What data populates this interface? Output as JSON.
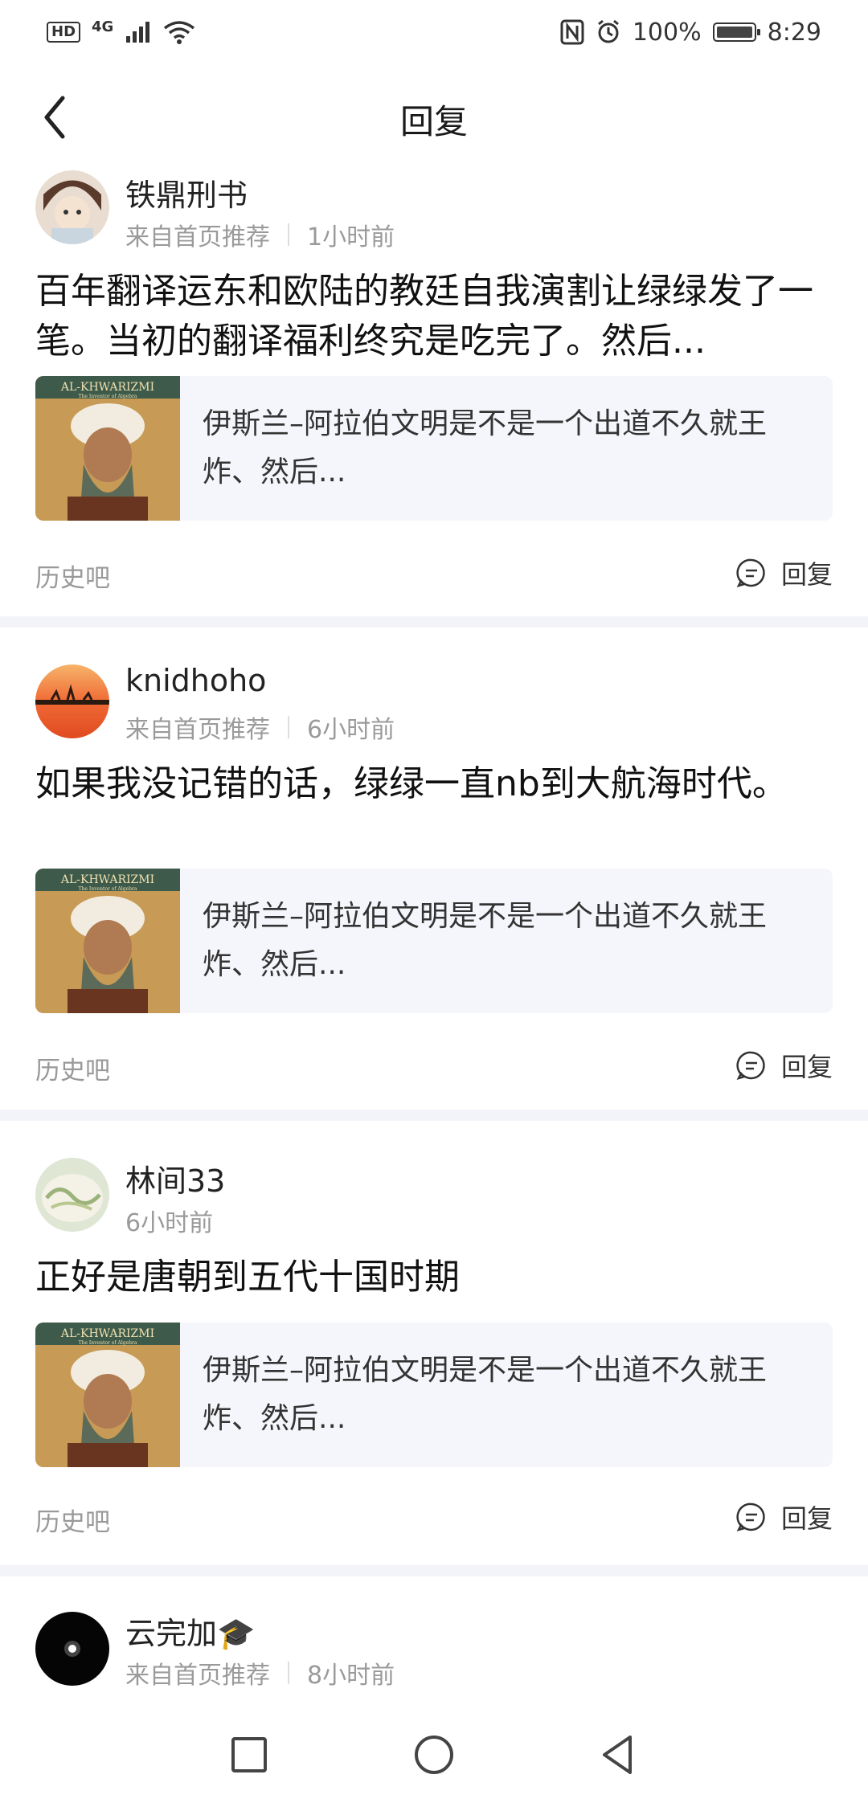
{
  "status_bar": {
    "hd": "HD",
    "network": "4G",
    "battery": "100%",
    "battery_level": 1.0,
    "time": "8:29"
  },
  "header": {
    "title": "回复"
  },
  "posts": [
    {
      "username": "铁鼎刑书",
      "source": "来自首页推荐",
      "time": "1小时前",
      "content": "百年翻译运东和欧陆的教廷自我演割让绿绿发了一笔。当初的翻译福利终究是吃完了。然后...",
      "quote_text": "伊斯兰–阿拉伯文明是不是一个出道不久就王炸、然后...",
      "forum": "历史吧",
      "reply_label": "回复"
    },
    {
      "username": "knidhoho",
      "source": "来自首页推荐",
      "time": "6小时前",
      "content": "如果我没记错的话，绿绿一直nb到大航海时代。",
      "quote_text": "伊斯兰–阿拉伯文明是不是一个出道不久就王炸、然后...",
      "forum": "历史吧",
      "reply_label": "回复"
    },
    {
      "username": "林间33",
      "source": "",
      "time": "6小时前",
      "content": "正好是唐朝到五代十国时期",
      "quote_text": "伊斯兰–阿拉伯文明是不是一个出道不久就王炸、然后...",
      "forum": "历史吧",
      "reply_label": "回复"
    },
    {
      "username": "云完加🎓",
      "source": "来自首页推荐",
      "time": "8小时前"
    }
  ],
  "book_cover": {
    "title": "AL-KHWARIZMI",
    "subtitle": "The Inventor of Algebra"
  }
}
